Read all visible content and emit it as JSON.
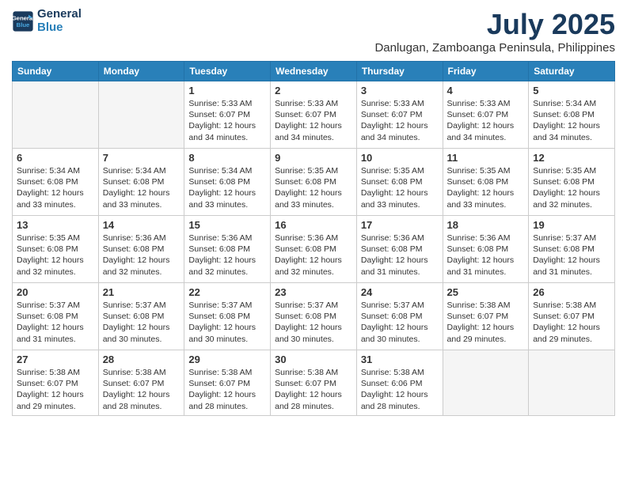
{
  "header": {
    "logo_line1": "General",
    "logo_line2": "Blue",
    "month_year": "July 2025",
    "location": "Danlugan, Zamboanga Peninsula, Philippines"
  },
  "day_headers": [
    "Sunday",
    "Monday",
    "Tuesday",
    "Wednesday",
    "Thursday",
    "Friday",
    "Saturday"
  ],
  "weeks": [
    [
      {
        "day": "",
        "content": ""
      },
      {
        "day": "",
        "content": ""
      },
      {
        "day": "1",
        "content": "Sunrise: 5:33 AM\nSunset: 6:07 PM\nDaylight: 12 hours and 34 minutes."
      },
      {
        "day": "2",
        "content": "Sunrise: 5:33 AM\nSunset: 6:07 PM\nDaylight: 12 hours and 34 minutes."
      },
      {
        "day": "3",
        "content": "Sunrise: 5:33 AM\nSunset: 6:07 PM\nDaylight: 12 hours and 34 minutes."
      },
      {
        "day": "4",
        "content": "Sunrise: 5:33 AM\nSunset: 6:07 PM\nDaylight: 12 hours and 34 minutes."
      },
      {
        "day": "5",
        "content": "Sunrise: 5:34 AM\nSunset: 6:08 PM\nDaylight: 12 hours and 34 minutes."
      }
    ],
    [
      {
        "day": "6",
        "content": "Sunrise: 5:34 AM\nSunset: 6:08 PM\nDaylight: 12 hours and 33 minutes."
      },
      {
        "day": "7",
        "content": "Sunrise: 5:34 AM\nSunset: 6:08 PM\nDaylight: 12 hours and 33 minutes."
      },
      {
        "day": "8",
        "content": "Sunrise: 5:34 AM\nSunset: 6:08 PM\nDaylight: 12 hours and 33 minutes."
      },
      {
        "day": "9",
        "content": "Sunrise: 5:35 AM\nSunset: 6:08 PM\nDaylight: 12 hours and 33 minutes."
      },
      {
        "day": "10",
        "content": "Sunrise: 5:35 AM\nSunset: 6:08 PM\nDaylight: 12 hours and 33 minutes."
      },
      {
        "day": "11",
        "content": "Sunrise: 5:35 AM\nSunset: 6:08 PM\nDaylight: 12 hours and 33 minutes."
      },
      {
        "day": "12",
        "content": "Sunrise: 5:35 AM\nSunset: 6:08 PM\nDaylight: 12 hours and 32 minutes."
      }
    ],
    [
      {
        "day": "13",
        "content": "Sunrise: 5:35 AM\nSunset: 6:08 PM\nDaylight: 12 hours and 32 minutes."
      },
      {
        "day": "14",
        "content": "Sunrise: 5:36 AM\nSunset: 6:08 PM\nDaylight: 12 hours and 32 minutes."
      },
      {
        "day": "15",
        "content": "Sunrise: 5:36 AM\nSunset: 6:08 PM\nDaylight: 12 hours and 32 minutes."
      },
      {
        "day": "16",
        "content": "Sunrise: 5:36 AM\nSunset: 6:08 PM\nDaylight: 12 hours and 32 minutes."
      },
      {
        "day": "17",
        "content": "Sunrise: 5:36 AM\nSunset: 6:08 PM\nDaylight: 12 hours and 31 minutes."
      },
      {
        "day": "18",
        "content": "Sunrise: 5:36 AM\nSunset: 6:08 PM\nDaylight: 12 hours and 31 minutes."
      },
      {
        "day": "19",
        "content": "Sunrise: 5:37 AM\nSunset: 6:08 PM\nDaylight: 12 hours and 31 minutes."
      }
    ],
    [
      {
        "day": "20",
        "content": "Sunrise: 5:37 AM\nSunset: 6:08 PM\nDaylight: 12 hours and 31 minutes."
      },
      {
        "day": "21",
        "content": "Sunrise: 5:37 AM\nSunset: 6:08 PM\nDaylight: 12 hours and 30 minutes."
      },
      {
        "day": "22",
        "content": "Sunrise: 5:37 AM\nSunset: 6:08 PM\nDaylight: 12 hours and 30 minutes."
      },
      {
        "day": "23",
        "content": "Sunrise: 5:37 AM\nSunset: 6:08 PM\nDaylight: 12 hours and 30 minutes."
      },
      {
        "day": "24",
        "content": "Sunrise: 5:37 AM\nSunset: 6:08 PM\nDaylight: 12 hours and 30 minutes."
      },
      {
        "day": "25",
        "content": "Sunrise: 5:38 AM\nSunset: 6:07 PM\nDaylight: 12 hours and 29 minutes."
      },
      {
        "day": "26",
        "content": "Sunrise: 5:38 AM\nSunset: 6:07 PM\nDaylight: 12 hours and 29 minutes."
      }
    ],
    [
      {
        "day": "27",
        "content": "Sunrise: 5:38 AM\nSunset: 6:07 PM\nDaylight: 12 hours and 29 minutes."
      },
      {
        "day": "28",
        "content": "Sunrise: 5:38 AM\nSunset: 6:07 PM\nDaylight: 12 hours and 28 minutes."
      },
      {
        "day": "29",
        "content": "Sunrise: 5:38 AM\nSunset: 6:07 PM\nDaylight: 12 hours and 28 minutes."
      },
      {
        "day": "30",
        "content": "Sunrise: 5:38 AM\nSunset: 6:07 PM\nDaylight: 12 hours and 28 minutes."
      },
      {
        "day": "31",
        "content": "Sunrise: 5:38 AM\nSunset: 6:06 PM\nDaylight: 12 hours and 28 minutes."
      },
      {
        "day": "",
        "content": ""
      },
      {
        "day": "",
        "content": ""
      }
    ]
  ]
}
